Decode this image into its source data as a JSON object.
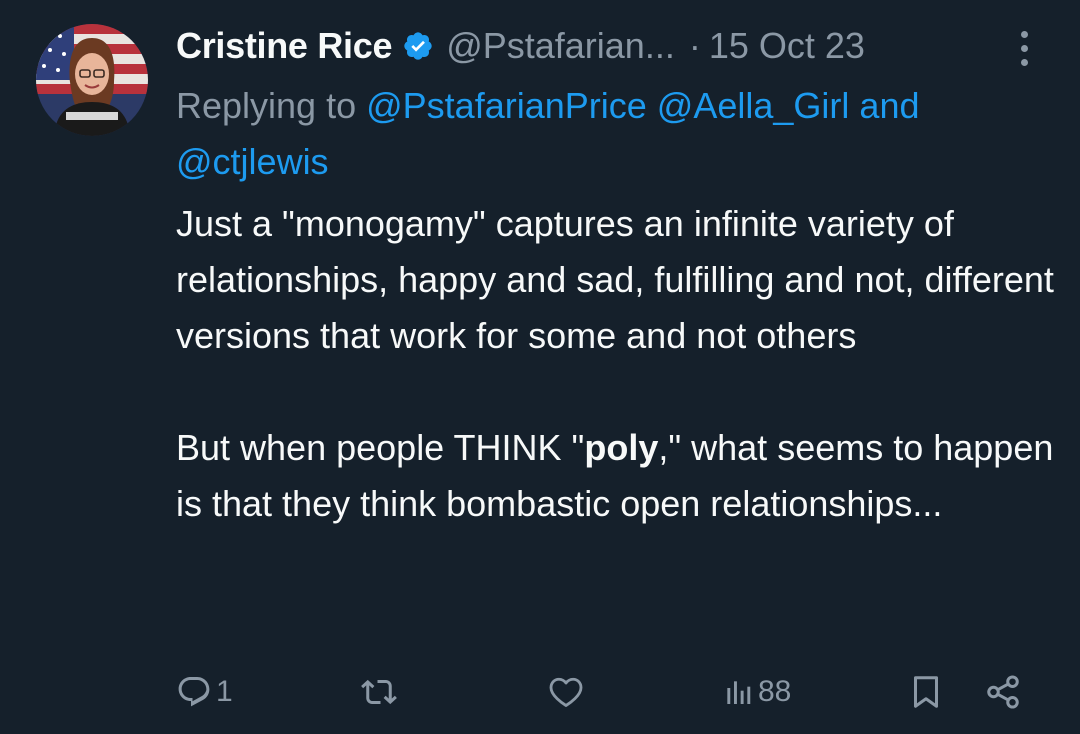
{
  "tweet": {
    "author_name": "Cristine Rice",
    "author_handle": "@Pstafarian...",
    "separator": "·",
    "date": "15 Oct 23",
    "replying_prefix": "Replying to",
    "mention_1": "@PstafarianPrice",
    "mention_2": "@Aella_Girl",
    "mention_joiner": "and",
    "mention_3": "@ctjlewis",
    "paragraph_1": "Just a \"monogamy\" captures an infinite variety of relationships, happy and sad, fulfilling and not, different versions that work for some and not others",
    "paragraph_2_before": "But when people THINK \"",
    "paragraph_2_bold": "poly",
    "paragraph_2_after": ",\" what seems to happen is that they think bombastic open relationships..."
  },
  "actions": {
    "reply_count": "1",
    "views_count": "88",
    "icons": {
      "reply": "reply-icon",
      "retweet": "retweet-icon",
      "like": "heart-icon",
      "views": "views-icon",
      "bookmark": "bookmark-icon",
      "share": "share-icon",
      "more": "more-icon",
      "verified": "verified-badge-icon"
    }
  },
  "colors": {
    "background": "#15202b",
    "text_primary": "#f7f9f9",
    "text_secondary": "#8b98a5",
    "accent": "#1d9bf0"
  }
}
